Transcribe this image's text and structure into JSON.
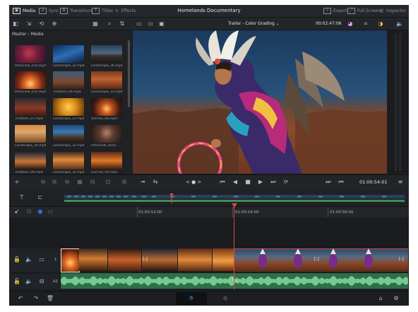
{
  "window": {
    "title": "Homelands Documentary"
  },
  "top_tabs": [
    {
      "label": "Media",
      "active": true
    },
    {
      "label": "Sync",
      "active": false
    },
    {
      "label": "Transitions",
      "active": false
    },
    {
      "label": "Titles",
      "active": false
    },
    {
      "label": "Effects",
      "active": false
    }
  ],
  "top_right": [
    {
      "label": "Export"
    },
    {
      "label": "Full Screen"
    },
    {
      "label": "Inspector"
    }
  ],
  "viewer": {
    "timeline_name": "Trailer - Color Grading",
    "timecode": "00:02:47:06",
    "playhead_timecode": "01:00:54:01",
    "jog_label": "< ● >"
  },
  "media_pool": {
    "title": "Master › Media",
    "items": [
      {
        "name": "Interview_010.mp4"
      },
      {
        "name": "Landscape_32.mp4"
      },
      {
        "name": "Landscape_36.mp4"
      },
      {
        "name": "Interview_010.mp4"
      },
      {
        "name": "Tradition_06.mp4"
      },
      {
        "name": "Landscape_33.mp4"
      },
      {
        "name": "Tradition_07.mp4"
      },
      {
        "name": "Landscape_12.mp4"
      },
      {
        "name": "Sunrise_08.mp4"
      },
      {
        "name": "Landscape_34.mp4"
      },
      {
        "name": "Landscape_31.mp4"
      },
      {
        "name": "Interview_Dock..."
      },
      {
        "name": "Tradition_08.mp4"
      },
      {
        "name": "Landscape_32.mp4"
      },
      {
        "name": "Sunrise_09.mp4"
      }
    ]
  },
  "timeline": {
    "ruler": [
      "01:00:52:00",
      "01:00:54:00",
      "01:00:56:00"
    ],
    "tracks": [
      {
        "label": "1"
      },
      {
        "label": "A1"
      }
    ],
    "playhead_label": "[-]"
  },
  "colors": {
    "accent": "#e0483e",
    "audio": "#3f8f5c",
    "selection": "#2d6fd6"
  }
}
